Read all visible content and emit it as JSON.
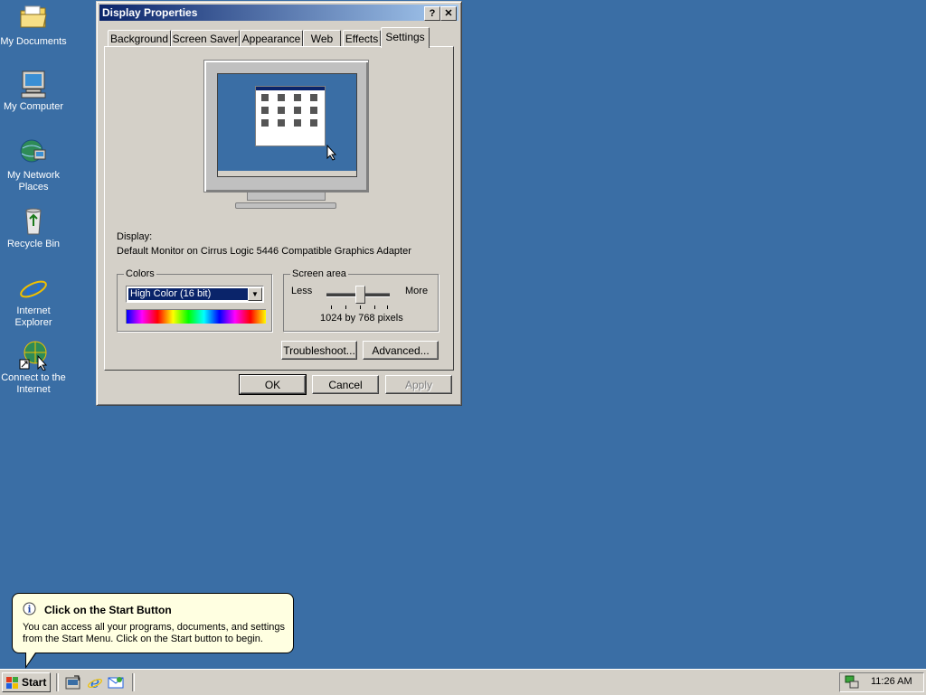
{
  "desktop": {
    "icons": [
      {
        "label": "My Documents",
        "icon": "folder-icon"
      },
      {
        "label": "My Computer",
        "icon": "computer-icon"
      },
      {
        "label": "My Network Places",
        "icon": "network-icon"
      },
      {
        "label": "Recycle Bin",
        "icon": "recycle-bin-icon"
      },
      {
        "label": "Internet Explorer",
        "icon": "ie-icon"
      },
      {
        "label": "Connect to the Internet",
        "icon": "connect-icon"
      }
    ]
  },
  "window": {
    "title": "Display Properties",
    "help_glyph": "?",
    "close_glyph": "✕",
    "tabs": [
      "Background",
      "Screen Saver",
      "Appearance",
      "Web",
      "Effects",
      "Settings"
    ],
    "active_tab": "Settings",
    "display_label": "Display:",
    "display_value": "Default Monitor on Cirrus Logic 5446 Compatible Graphics Adapter",
    "colors_group": "Colors",
    "colors_value": "High Color (16 bit)",
    "screen_area_group": "Screen area",
    "less_label": "Less",
    "more_label": "More",
    "resolution_text": "1024 by 768 pixels",
    "troubleshoot_label": "Troubleshoot...",
    "advanced_label": "Advanced...",
    "ok_label": "OK",
    "cancel_label": "Cancel",
    "apply_label": "Apply"
  },
  "balloon": {
    "title": "Click on the Start Button",
    "body_line1": "You can access all your programs, documents, and settings",
    "body_line2": "from the Start Menu. Click on the Start button to begin."
  },
  "taskbar": {
    "start_label": "Start",
    "clock": "11:26 AM"
  },
  "colors": {
    "desktop": "#3a6ea5",
    "titlebar": "#0a246a",
    "face": "#d4d0c8",
    "tooltip": "#ffffe1"
  }
}
